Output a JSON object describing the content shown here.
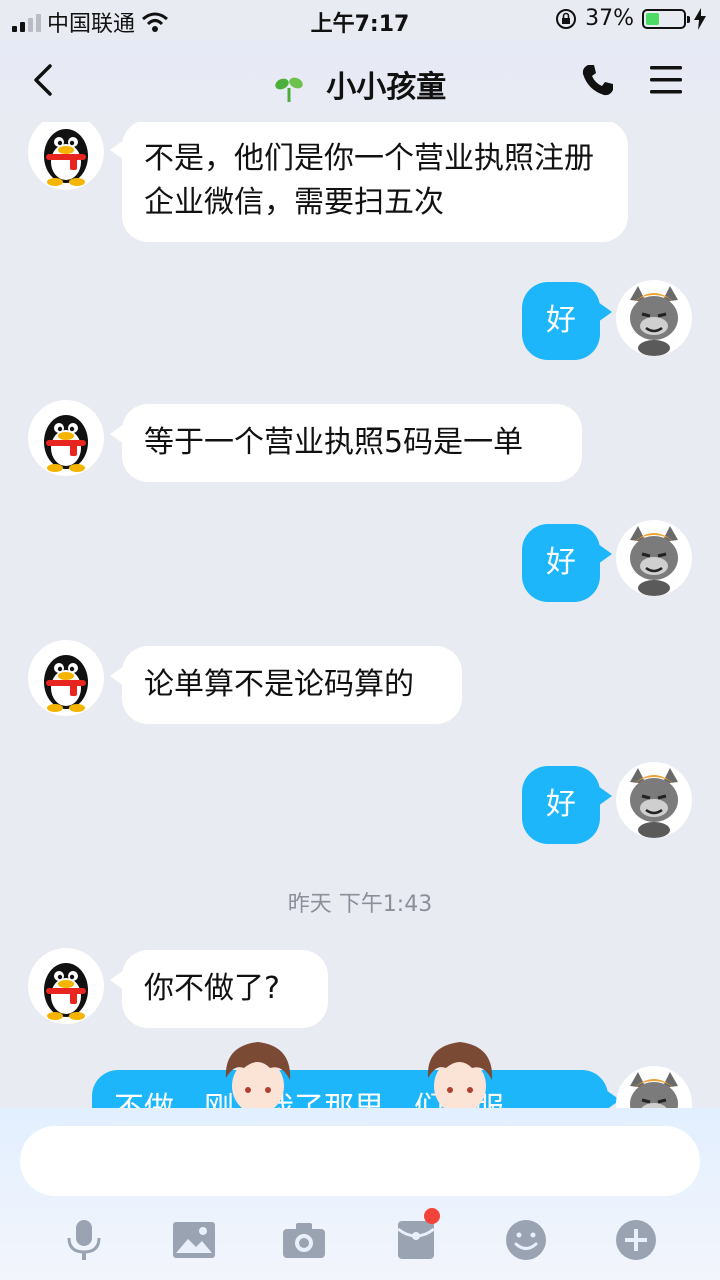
{
  "status_bar": {
    "carrier": "中国联通",
    "time": "上午7:17",
    "battery": "37%",
    "battery_level": 0.37
  },
  "header": {
    "title": "小小孩童",
    "back_icon": "chevron-left-icon",
    "call_icon": "phone-icon",
    "menu_icon": "menu-icon"
  },
  "messages": [
    {
      "side": "in",
      "text": "不是，他们是你一个营业执照注册企业微信，需要扫五次",
      "avatar": "qq-penguin"
    },
    {
      "side": "out",
      "text": "好",
      "avatar": "grey-wolf"
    },
    {
      "side": "in",
      "text": "等于一个营业执照5码是一单",
      "avatar": "qq-penguin"
    },
    {
      "side": "out",
      "text": "好",
      "avatar": "grey-wolf"
    },
    {
      "side": "in",
      "text": "论单算不是论码算的",
      "avatar": "qq-penguin"
    },
    {
      "side": "out",
      "text": "好",
      "avatar": "grey-wolf"
    },
    {
      "side": "time",
      "text": "昨天 下午1:43"
    },
    {
      "side": "in",
      "text": "你不做了?",
      "avatar": "qq-penguin"
    },
    {
      "side": "out",
      "text": "不做，刚…我了那里…们客服",
      "avatar": "grey-wolf"
    }
  ],
  "composer": {
    "placeholder": "",
    "tools": [
      "microphone-icon",
      "image-icon",
      "camera-icon",
      "red-packet-icon",
      "emoji-icon",
      "plus-icon"
    ]
  },
  "colors": {
    "accent": "#1eb6fa",
    "background": "#e9ebf3",
    "badge": "#f4433a"
  }
}
